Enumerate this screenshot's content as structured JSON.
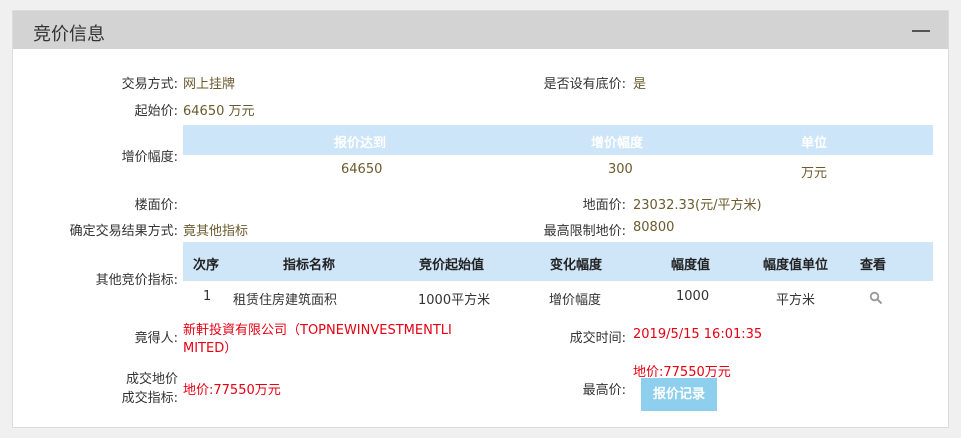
{
  "panel": {
    "title": "竞价信息"
  },
  "fields": {
    "trade_method_label": "交易方式:",
    "trade_method_value": "网上挂牌",
    "reserve_price_label": "是否设有底价:",
    "reserve_price_value": "是",
    "start_price_label": "起始价:",
    "start_price_value": "64650 万元",
    "increment_label": "增价幅度:",
    "floor_price_label": "楼面价:",
    "floor_price_value": "",
    "land_price_label": "地面价:",
    "land_price_value": "23032.33(元/平方米)",
    "result_method_label": "确定交易结果方式:",
    "result_method_value": "竟其他指标",
    "max_limit_label": "最高限制地价:",
    "max_limit_value": "80800",
    "other_indicators_label": "其他竞价指标:",
    "winner_label": "竟得人:",
    "winner_line1": "新軒投資有限公司（TOPNEWINVESTMENTLI",
    "winner_line2": "MITED）",
    "deal_time_label": "成交时间:",
    "deal_time_value": "2019/5/15 16:01:35",
    "deal_indicator_label_line1": "成交地价",
    "deal_indicator_label_line2": "成交指标:",
    "deal_indicator_value": "地价:77550万元",
    "highest_price_label": "最高价:",
    "highest_price_value": "地价:77550万元",
    "record_button": "报价记录"
  },
  "increment_table": {
    "headers": [
      "报价达到",
      "增价幅度",
      "单位"
    ],
    "row": [
      "64650",
      "300",
      "万元"
    ]
  },
  "indicator_table": {
    "headers": [
      "次序",
      "指标名称",
      "竞价起始值",
      "变化幅度",
      "幅度值",
      "幅度值单位",
      "查看"
    ],
    "row": [
      "1",
      "租赁住房建筑面积",
      "1000平方米",
      "增价幅度",
      "1000",
      "平方米"
    ]
  }
}
